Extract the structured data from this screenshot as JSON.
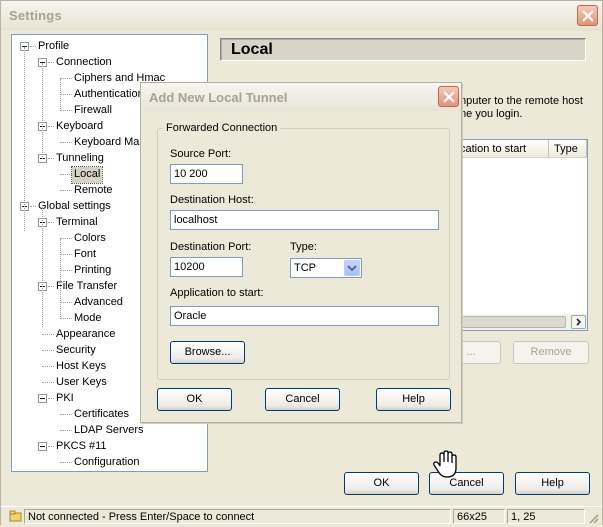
{
  "settings": {
    "title": "Settings",
    "tree": [
      {
        "label": "Profile",
        "level": 0,
        "expander": true
      },
      {
        "label": "Connection",
        "level": 1,
        "expander": true
      },
      {
        "label": "Ciphers and Hmac",
        "level": 2
      },
      {
        "label": "Authentication",
        "level": 2
      },
      {
        "label": "Firewall",
        "level": 2
      },
      {
        "label": "Keyboard",
        "level": 1,
        "expander": true
      },
      {
        "label": "Keyboard Map",
        "level": 2
      },
      {
        "label": "Tunneling",
        "level": 1,
        "expander": true
      },
      {
        "label": "Local",
        "level": 2,
        "selected": true
      },
      {
        "label": "Remote",
        "level": 2
      },
      {
        "label": "Global settings",
        "level": 0,
        "expander": true
      },
      {
        "label": "Terminal",
        "level": 1,
        "expander": true
      },
      {
        "label": "Colors",
        "level": 2
      },
      {
        "label": "Font",
        "level": 2
      },
      {
        "label": "Printing",
        "level": 2
      },
      {
        "label": "File Transfer",
        "level": 1,
        "expander": true
      },
      {
        "label": "Advanced",
        "level": 2
      },
      {
        "label": "Mode",
        "level": 2
      },
      {
        "label": "Appearance",
        "level": 1
      },
      {
        "label": "Security",
        "level": 1
      },
      {
        "label": "Host Keys",
        "level": 1
      },
      {
        "label": "User Keys",
        "level": 1
      },
      {
        "label": "PKI",
        "level": 1,
        "expander": true
      },
      {
        "label": "Certificates",
        "level": 2
      },
      {
        "label": "LDAP Servers",
        "level": 2
      },
      {
        "label": "PKCS #11",
        "level": 1,
        "expander": true
      },
      {
        "label": "Configuration",
        "level": 2
      }
    ],
    "section_title": "Local",
    "description_line1": "mputer to the remote host",
    "description_line2": "me you login.",
    "list_columns": [
      "plication to start",
      "Type"
    ],
    "edit_button": "...",
    "remove_button": "Remove",
    "ok_button": "OK",
    "cancel_button": "Cancel",
    "help_button": "Help",
    "status": {
      "message": "Not connected - Press Enter/Space to connect",
      "size": "66x25",
      "position": "1, 25"
    }
  },
  "dialog": {
    "title": "Add New Local Tunnel",
    "group_label": "Forwarded Connection",
    "source_port_label": "Source Port:",
    "source_port_value": "10 200",
    "destination_host_label": "Destination Host:",
    "destination_host_value": "localhost",
    "destination_port_label": "Destination Port:",
    "destination_port_value": "10200",
    "type_label": "Type:",
    "type_value": "TCP",
    "application_label": "Application to start:",
    "application_value": "Oracle",
    "browse_button": "Browse...",
    "ok_button": "OK",
    "cancel_button": "Cancel",
    "help_button": "Help"
  },
  "colors": {
    "window_bg": "#ece9d8",
    "field_border": "#7f9db9",
    "button_border": "#003c74",
    "close_button": "#e29279"
  }
}
